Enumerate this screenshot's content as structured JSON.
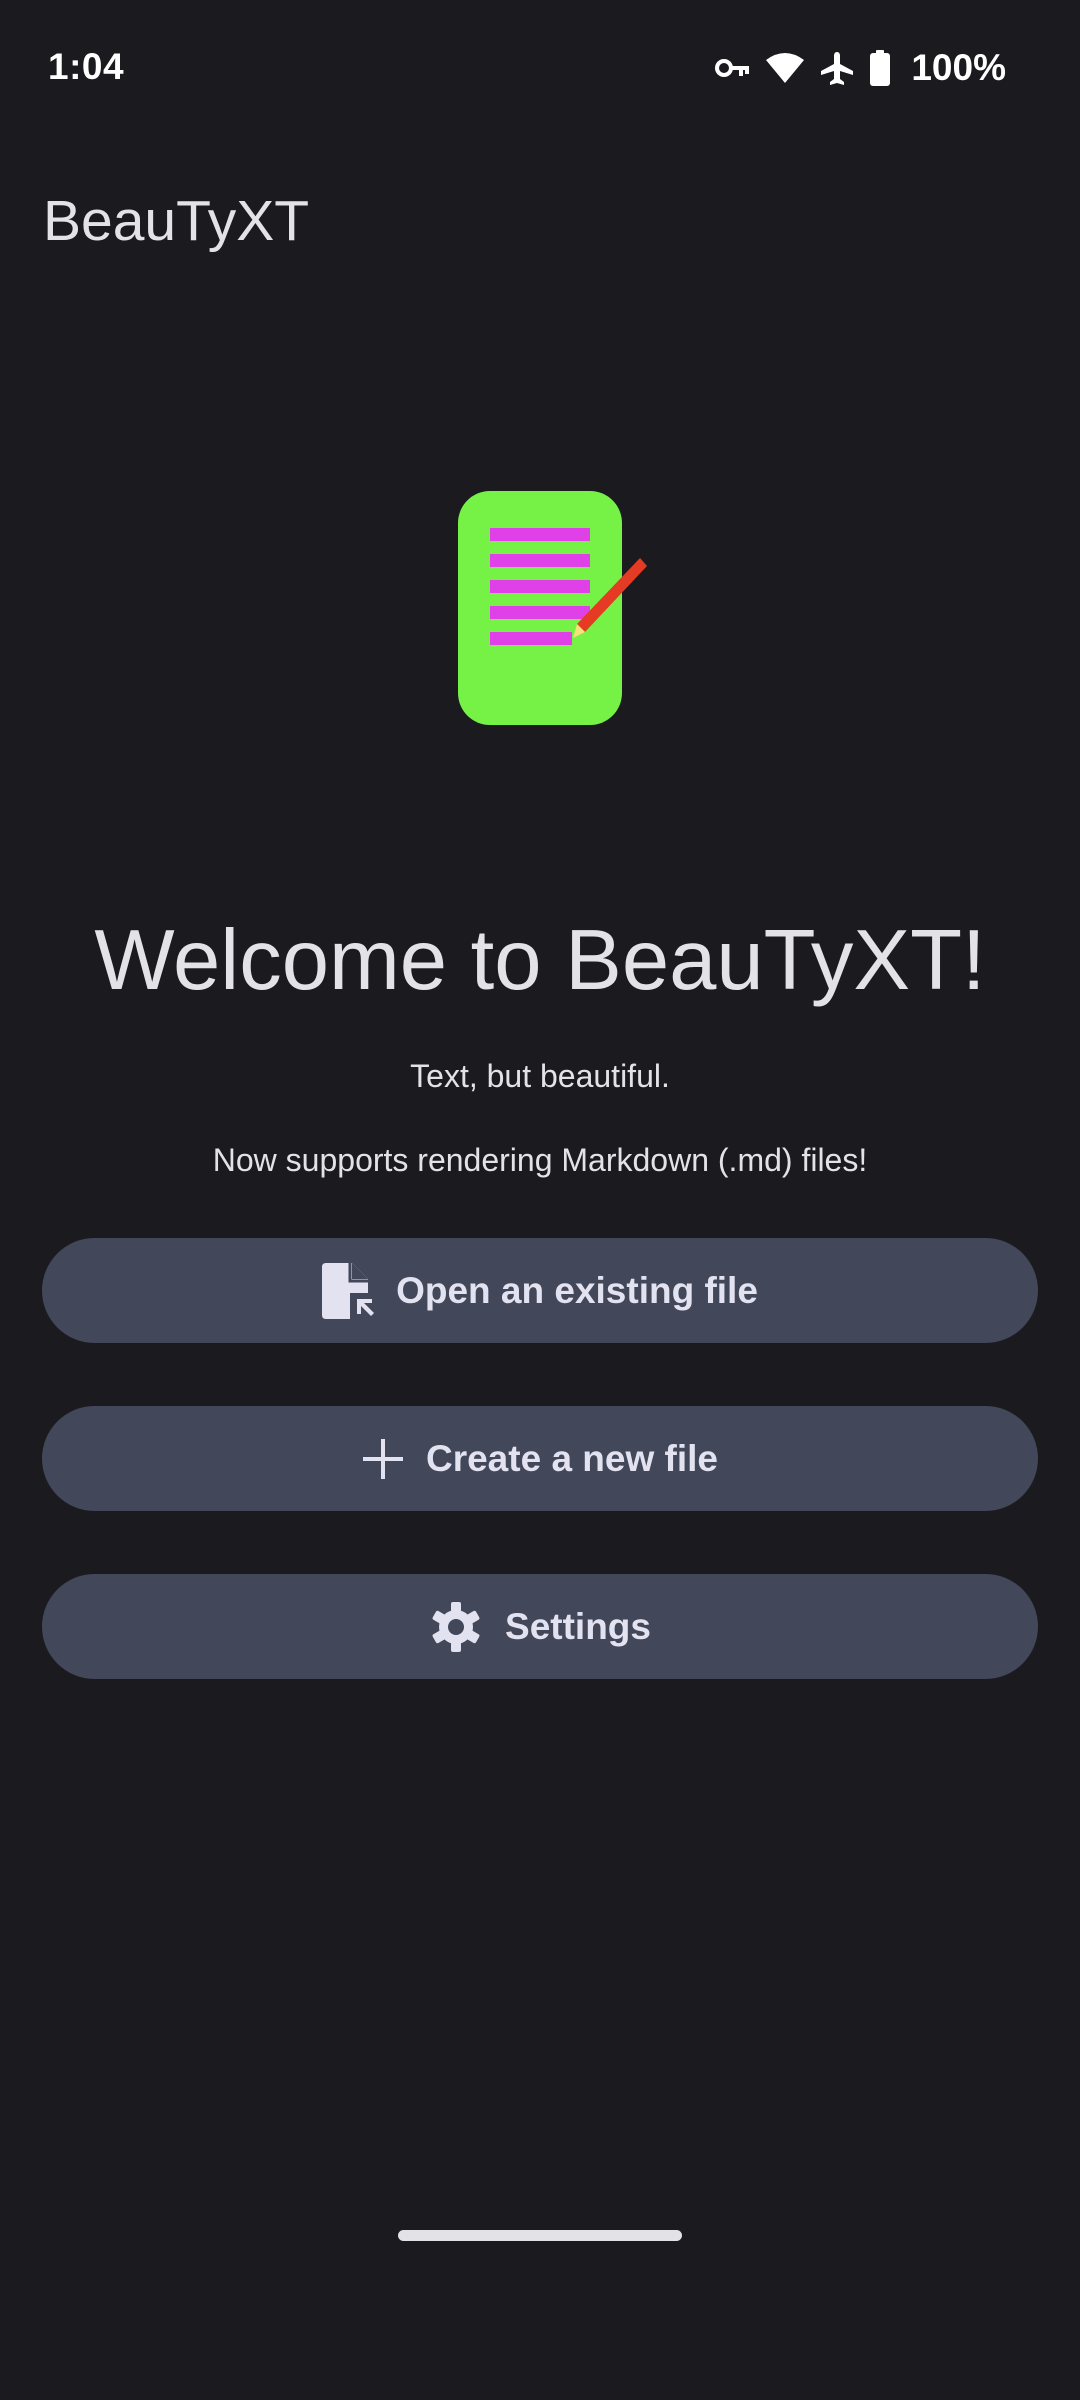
{
  "status_bar": {
    "time": "1:04",
    "battery_percent": "100%",
    "icons": [
      "vpn-key-icon",
      "wifi-icon",
      "airplane-mode-icon",
      "battery-icon"
    ]
  },
  "app_bar": {
    "title": "BeauTyXT"
  },
  "logo": {
    "icon": "app-logo-icon",
    "colors": {
      "page": "#76f246",
      "lines": "#e040e8",
      "pencil": "#e53a24",
      "pencil_tip": "#f6e27a"
    }
  },
  "welcome": {
    "title": "Welcome to BeauTyXT!",
    "tagline": "Text, but beautiful.",
    "note": "Now supports rendering Markdown (.md) files!"
  },
  "actions": {
    "open_label": "Open an existing file",
    "open_icon": "file-open-icon",
    "create_label": "Create a new file",
    "create_icon": "plus-icon",
    "settings_label": "Settings",
    "settings_icon": "gear-icon"
  },
  "theme": {
    "background": "#1b1b1f",
    "button_background": "#424759",
    "text": "#e3e2e6"
  }
}
